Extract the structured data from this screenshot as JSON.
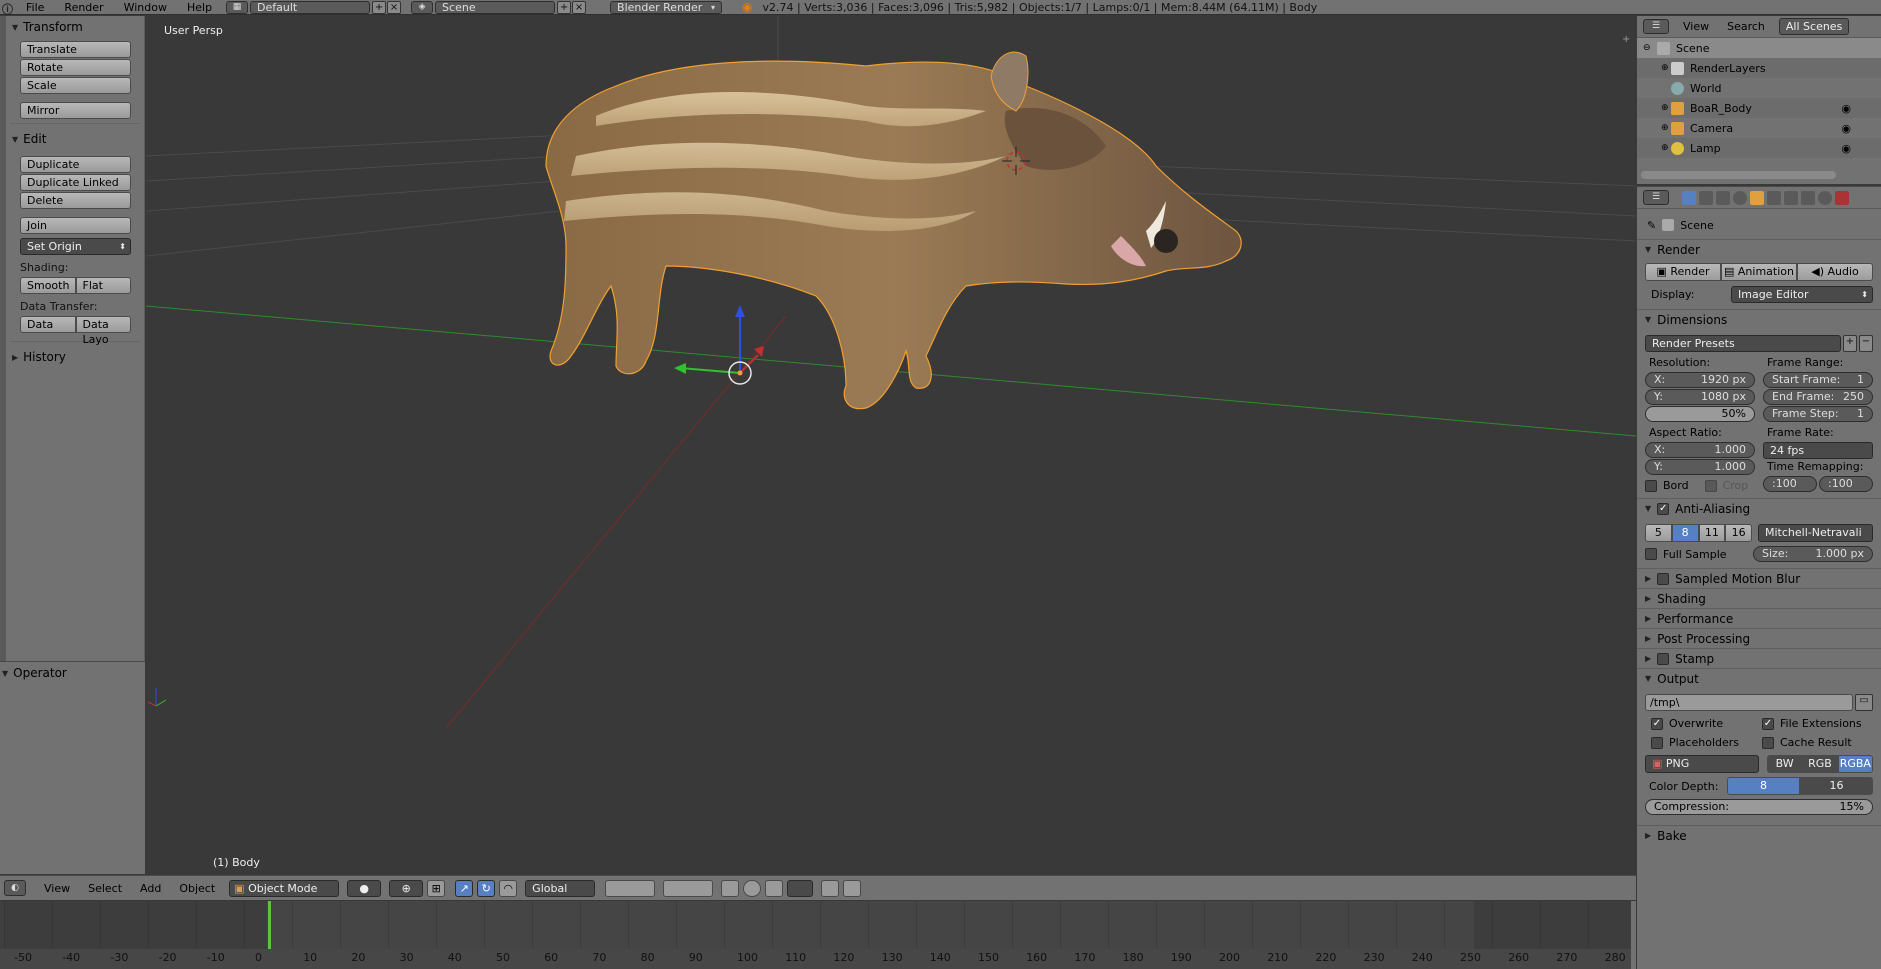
{
  "topbar": {
    "menus": [
      "File",
      "Render",
      "Window",
      "Help"
    ],
    "layout": "Default",
    "scene": "Scene",
    "engine": "Blender Render",
    "stats": "v2.74 | Verts:3,036 | Faces:3,096 | Tris:5,982 | Objects:1/7 | Lamps:0/1 | Mem:8.44M (64.11M) | Body"
  },
  "toolshelf": {
    "transform_title": "Transform",
    "translate": "Translate",
    "rotate": "Rotate",
    "scale": "Scale",
    "mirror": "Mirror",
    "edit_title": "Edit",
    "duplicate": "Duplicate",
    "duplicate_linked": "Duplicate Linked",
    "delete": "Delete",
    "join": "Join",
    "set_origin": "Set Origin",
    "shading_label": "Shading:",
    "smooth": "Smooth",
    "flat": "Flat",
    "data_transfer_label": "Data Transfer:",
    "data": "Data",
    "data_layout": "Data Layo",
    "history_title": "History",
    "operator_title": "Operator"
  },
  "viewport": {
    "persp_label": "User Persp",
    "object_label": "(1) Body"
  },
  "outliner": {
    "view": "View",
    "search": "Search",
    "all_scenes": "All Scenes",
    "rows": [
      "Scene",
      "RenderLayers",
      "World",
      "BoaR_Body",
      "Camera",
      "Lamp"
    ]
  },
  "props": {
    "context": "Scene",
    "render_title": "Render",
    "render_btn": "Render",
    "animation_btn": "Animation",
    "audio_btn": "Audio",
    "display_label": "Display:",
    "display_value": "Image Editor",
    "dimensions_title": "Dimensions",
    "render_presets": "Render Presets",
    "resolution_label": "Resolution:",
    "res_x_label": "X:",
    "res_x": "1920 px",
    "res_y_label": "Y:",
    "res_y": "1080 px",
    "res_pct": "50%",
    "frame_range_label": "Frame Range:",
    "start_frame_label": "Start Frame:",
    "start_frame": "1",
    "end_frame_label": "End Frame:",
    "end_frame": "250",
    "frame_step_label": "Frame Step:",
    "frame_step": "1",
    "aspect_label": "Aspect Ratio:",
    "aspect_x_label": "X:",
    "aspect_x": "1.000",
    "aspect_y_label": "Y:",
    "aspect_y": "1.000",
    "frame_rate_label": "Frame Rate:",
    "frame_rate": "24 fps",
    "time_remap_label": "Time Remapping:",
    "remap_old": ":100",
    "remap_new": ":100",
    "bord": "Bord",
    "crop": "Crop",
    "aa_title": "Anti-Aliasing",
    "aa_samples": [
      "5",
      "8",
      "11",
      "16"
    ],
    "aa_filter": "Mitchell-Netravali",
    "full_sample": "Full Sample",
    "aa_size_label": "Size:",
    "aa_size": "1.000 px",
    "smb_title": "Sampled Motion Blur",
    "shading_title": "Shading",
    "performance_title": "Performance",
    "post_title": "Post Processing",
    "stamp_title": "Stamp",
    "output_title": "Output",
    "output_path": "/tmp\\",
    "overwrite": "Overwrite",
    "file_ext": "File Extensions",
    "placeholders": "Placeholders",
    "cache_result": "Cache Result",
    "format": "PNG",
    "bw": "BW",
    "rgb": "RGB",
    "rgba": "RGBA",
    "color_depth_label": "Color Depth:",
    "depth_8": "8",
    "depth_16": "16",
    "compression_label": "Compression:",
    "compression": "15%",
    "bake_title": "Bake"
  },
  "vheader": {
    "view": "View",
    "select": "Select",
    "add": "Add",
    "object": "Object",
    "mode": "Object Mode",
    "orientation": "Global"
  },
  "timeline": {
    "ticks": [
      "-50",
      "-40",
      "-30",
      "-20",
      "-10",
      "0",
      "10",
      "20",
      "30",
      "40",
      "50",
      "60",
      "70",
      "80",
      "90",
      "100",
      "110",
      "120",
      "130",
      "140",
      "150",
      "160",
      "170",
      "180",
      "190",
      "200",
      "210",
      "220",
      "230",
      "240",
      "250",
      "260",
      "270",
      "280"
    ]
  },
  "colors": {
    "accent": "#5680c2",
    "selection_outline": "#f0a030",
    "x_axis": "#c03030",
    "y_axis": "#30c030",
    "z_axis": "#3050e0"
  }
}
